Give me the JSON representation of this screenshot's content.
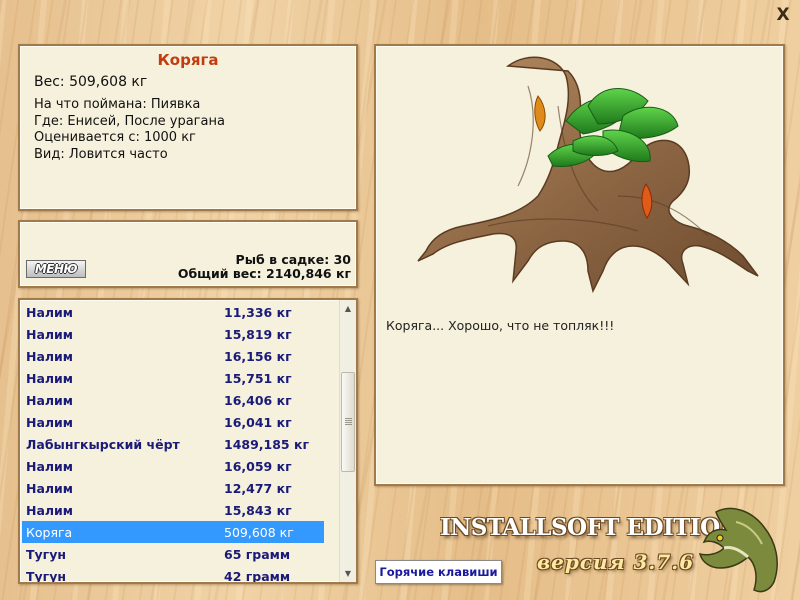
{
  "window": {
    "close_label": "X"
  },
  "catch": {
    "title": "Коряга",
    "weight": "Вес: 509,608 кг",
    "details": [
      "На что поймана: Пиявка",
      "Где: Енисей, После урагана",
      "Оценивается с: 1000 кг",
      "Вид: Ловится часто"
    ]
  },
  "keeper": {
    "menu_label": "МЕНЮ",
    "fish_count": "Рыб в садке: 30",
    "total_weight": "Общий вес: 2140,846 кг"
  },
  "fish_list": {
    "rows": [
      {
        "name": "Налим",
        "weight": "11,336 кг"
      },
      {
        "name": "Налим",
        "weight": "15,819 кг"
      },
      {
        "name": "Налим",
        "weight": "16,156 кг"
      },
      {
        "name": "Налим",
        "weight": "15,751 кг"
      },
      {
        "name": "Налим",
        "weight": "16,406 кг"
      },
      {
        "name": "Налим",
        "weight": "16,041 кг"
      },
      {
        "name": "Лабынгкырский чёрт",
        "weight": "1489,185 кг"
      },
      {
        "name": "Налим",
        "weight": "16,059 кг"
      },
      {
        "name": "Налим",
        "weight": "12,477 кг"
      },
      {
        "name": "Налим",
        "weight": "15,843 кг"
      },
      {
        "name": "Коряга",
        "weight": "509,608 кг"
      },
      {
        "name": "Тугун",
        "weight": "65 грамм"
      },
      {
        "name": "Тугун",
        "weight": "42 грамм"
      }
    ],
    "selected_index": 10
  },
  "picture": {
    "comment": "Коряга... Хорошо, что не топляк!!!"
  },
  "brand": {
    "edition": "INSTALLSOFT EDITION",
    "version": "версия 3.7.6"
  },
  "hotkeys": {
    "label": "Горячие клавиши"
  }
}
